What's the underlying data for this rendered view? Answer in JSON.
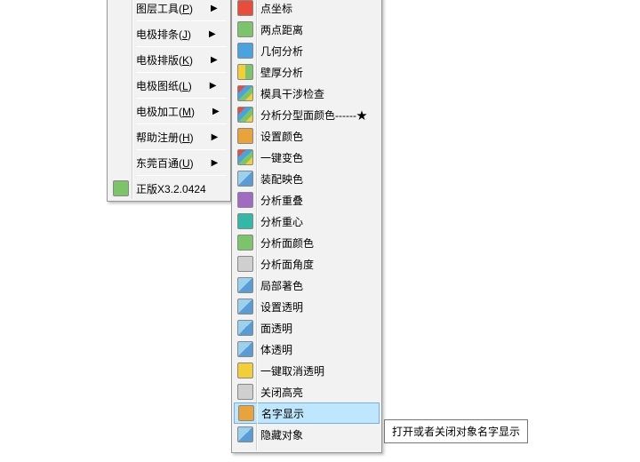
{
  "left_menu": {
    "items": [
      {
        "label": "图层工具",
        "hotkey": "P",
        "has_submenu": true
      },
      {
        "label": "电极排条",
        "hotkey": "J",
        "has_submenu": true
      },
      {
        "label": "电极排版",
        "hotkey": "K",
        "has_submenu": true
      },
      {
        "label": "电极图纸",
        "hotkey": "L",
        "has_submenu": true
      },
      {
        "label": "电极加工",
        "hotkey": "M",
        "has_submenu": true
      },
      {
        "label": "帮助注册",
        "hotkey": "H",
        "has_submenu": true
      },
      {
        "label": "东莞百通",
        "hotkey": "U",
        "has_submenu": true
      },
      {
        "label": "正版X3.2.0424",
        "hotkey": "",
        "has_submenu": false,
        "icon": true
      }
    ]
  },
  "right_menu": {
    "items": [
      {
        "label": "点坐标",
        "icon_color": "c-red"
      },
      {
        "label": "两点距离",
        "icon_color": "c-green"
      },
      {
        "label": "几何分析",
        "icon_color": "c-blue"
      },
      {
        "label": "壁厚分析",
        "icon_color": "c-yg"
      },
      {
        "label": "模具干涉检查",
        "icon_color": "c-multi"
      },
      {
        "label": "分析分型面颜色------★",
        "icon_color": "c-multi"
      },
      {
        "label": "设置颜色",
        "icon_color": "c-orange"
      },
      {
        "label": "一键变色",
        "icon_color": "c-multi"
      },
      {
        "label": "装配映色",
        "icon_color": "c-cube"
      },
      {
        "label": "分析重叠",
        "icon_color": "c-purple"
      },
      {
        "label": "分析重心",
        "icon_color": "c-teal"
      },
      {
        "label": "分析面颜色",
        "icon_color": "c-green"
      },
      {
        "label": "分析面角度",
        "icon_color": "c-gray"
      },
      {
        "label": "局部著色",
        "icon_color": "c-cube"
      },
      {
        "label": "设置透明",
        "icon_color": "c-cube"
      },
      {
        "label": "面透明",
        "icon_color": "c-cube"
      },
      {
        "label": "体透明",
        "icon_color": "c-cube"
      },
      {
        "label": "一键取消透明",
        "icon_color": "c-yellow"
      },
      {
        "label": "关闭高亮",
        "icon_color": "c-gray"
      },
      {
        "label": "名字显示",
        "icon_color": "c-orange",
        "highlight": true
      },
      {
        "label": "隐藏对象",
        "icon_color": "c-cube"
      }
    ]
  },
  "tooltip": "打开或者关闭对象名字显示"
}
